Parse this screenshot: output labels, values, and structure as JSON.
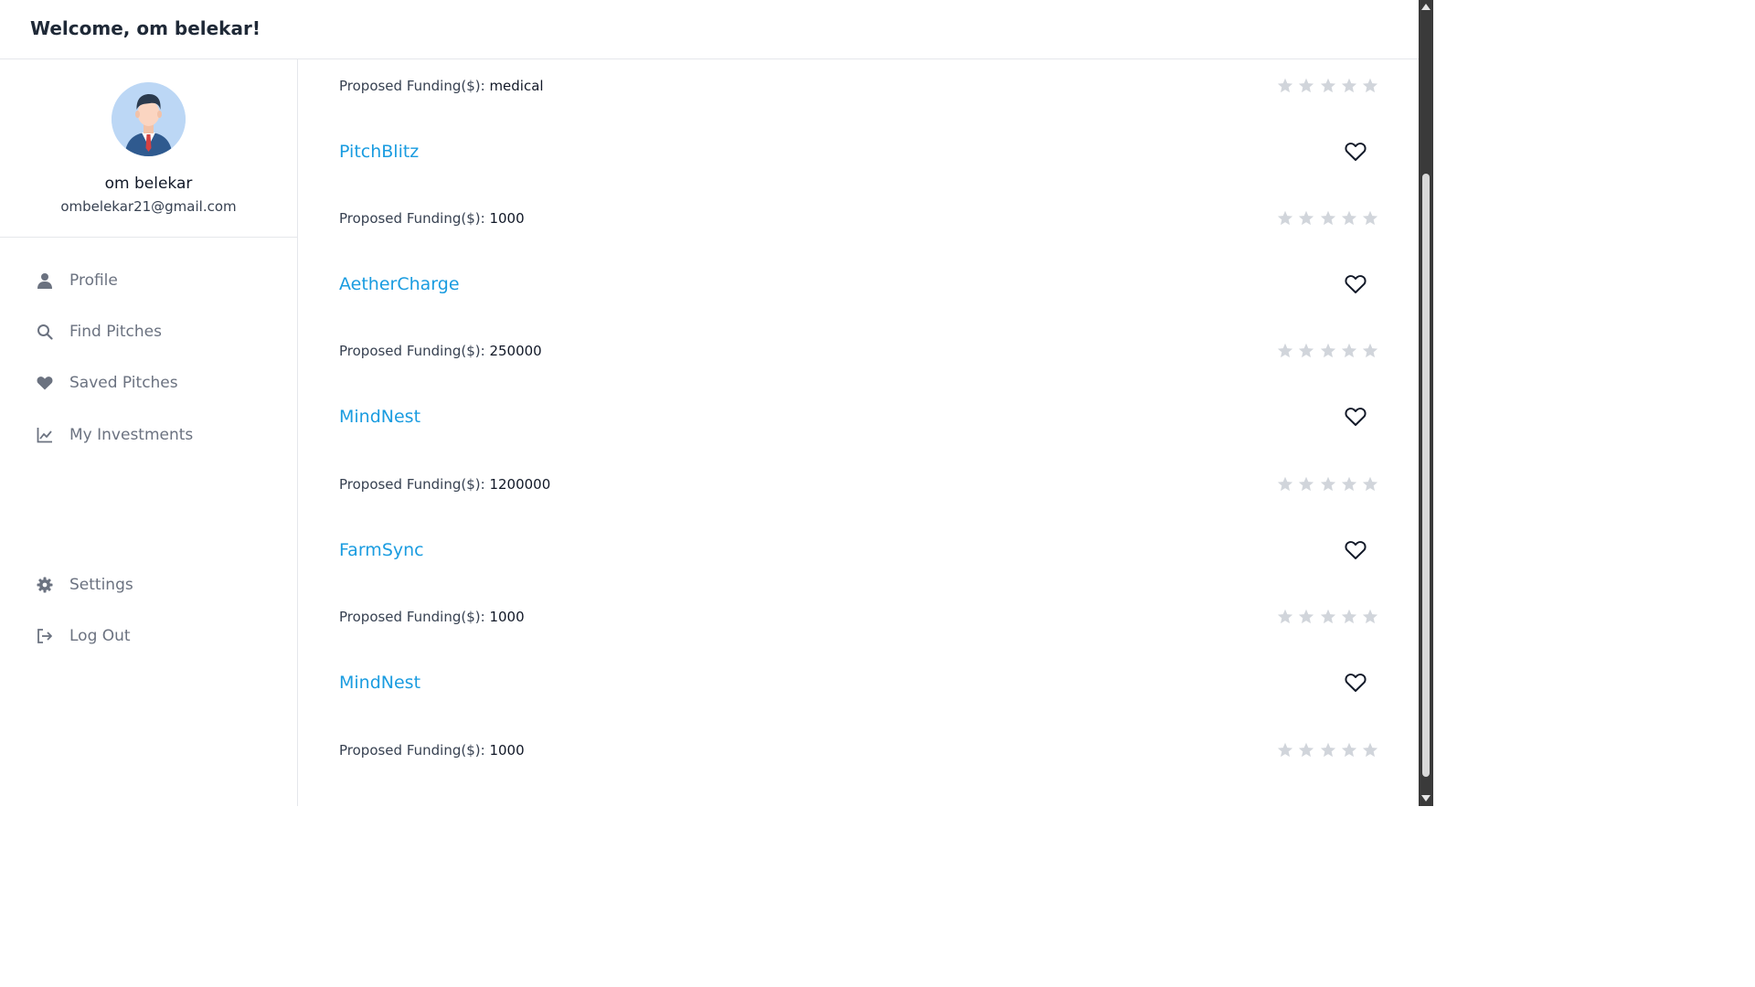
{
  "header": {
    "welcome": "Welcome, om belekar!"
  },
  "user": {
    "name": "om belekar",
    "email": "ombelekar21@gmail.com",
    "avatar_icon": "businessman-avatar-icon"
  },
  "nav": {
    "items": [
      {
        "label": "Profile",
        "icon": "user-icon"
      },
      {
        "label": "Find Pitches",
        "icon": "search-icon"
      },
      {
        "label": "Saved Pitches",
        "icon": "heart-icon"
      },
      {
        "label": "My Investments",
        "icon": "chart-line-icon"
      }
    ],
    "bottom_items": [
      {
        "label": "Settings",
        "icon": "gear-icon"
      },
      {
        "label": "Log Out",
        "icon": "logout-icon"
      }
    ]
  },
  "funding_label": "Proposed Funding($): ",
  "top_funding_value": "medical",
  "pitches": [
    {
      "name": "PitchBlitz",
      "funding": "1000",
      "rating": 0
    },
    {
      "name": "AetherCharge",
      "funding": "250000",
      "rating": 0
    },
    {
      "name": "MindNest",
      "funding": "1200000",
      "rating": 0
    },
    {
      "name": "FarmSync",
      "funding": "1000",
      "rating": 0
    },
    {
      "name": "MindNest",
      "funding": "1000",
      "rating": 0
    }
  ],
  "colors": {
    "link": "#1a9ce0",
    "star_empty": "#d1d5db",
    "nav_text": "#6b7280"
  }
}
